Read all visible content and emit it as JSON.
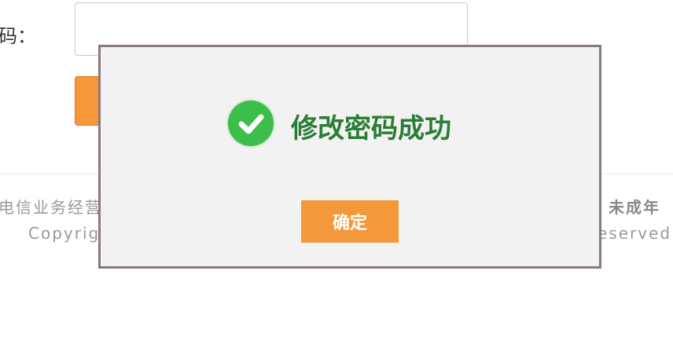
{
  "form": {
    "password_label": "码：",
    "password_value": "",
    "submit_label": ""
  },
  "footer": {
    "line1_left": "电信业务经营",
    "line1_right": "未成年",
    "line2_left": "Copyrig",
    "line2_right": "eserved"
  },
  "modal": {
    "icon": "check-circle-icon",
    "message": "修改密码成功",
    "confirm_label": "确定"
  },
  "colors": {
    "accent_orange": "#f7963b",
    "success_green": "#3bbf4a",
    "message_green": "#2a7e34",
    "modal_bg": "#f2f2f2",
    "modal_border": "#8a7a7a"
  }
}
